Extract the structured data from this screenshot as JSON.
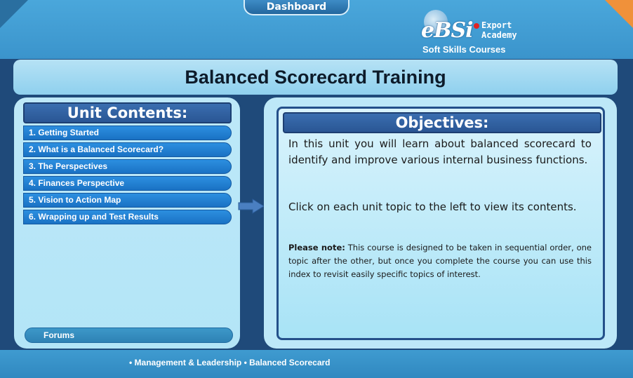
{
  "header": {
    "dashboard_label": "Dashboard",
    "logo": {
      "brand": "eBSi",
      "line1": "Export",
      "line2": "Academy",
      "tagline": "Soft Skills Courses"
    }
  },
  "title": "Balanced Scorecard Training",
  "sidebar": {
    "heading": "Unit Contents:",
    "items": [
      {
        "label": "1. Getting Started"
      },
      {
        "label": "2. What is a Balanced Scorecard?"
      },
      {
        "label": "3. The Perspectives"
      },
      {
        "label": "4. Finances Perspective"
      },
      {
        "label": "5. Vision to Action Map"
      },
      {
        "label": "6. Wrapping up and Test Results"
      }
    ],
    "forums_label": "Forums"
  },
  "main": {
    "heading": "Objectives:",
    "para1": "In this unit you will learn about balanced scorecard to identify and improve various internal business functions.",
    "para2": "Click on each unit topic to the left to view its contents.",
    "note_label": "Please note:",
    "note_text": " This course is designed to be taken in sequential order, one topic after the other, but once you complete the course you can use this index to revisit easily specific topics of interest."
  },
  "footer": {
    "breadcrumb": "• Management & Leadership  • Balanced Scorecard"
  },
  "colors": {
    "frame": "#3f9bd0",
    "inner": "#1f4a7a",
    "panel": "#bde8f8",
    "menu_item": "#1a72c4",
    "header_box": "#2a5694",
    "accent_corner": "#f0913a"
  }
}
